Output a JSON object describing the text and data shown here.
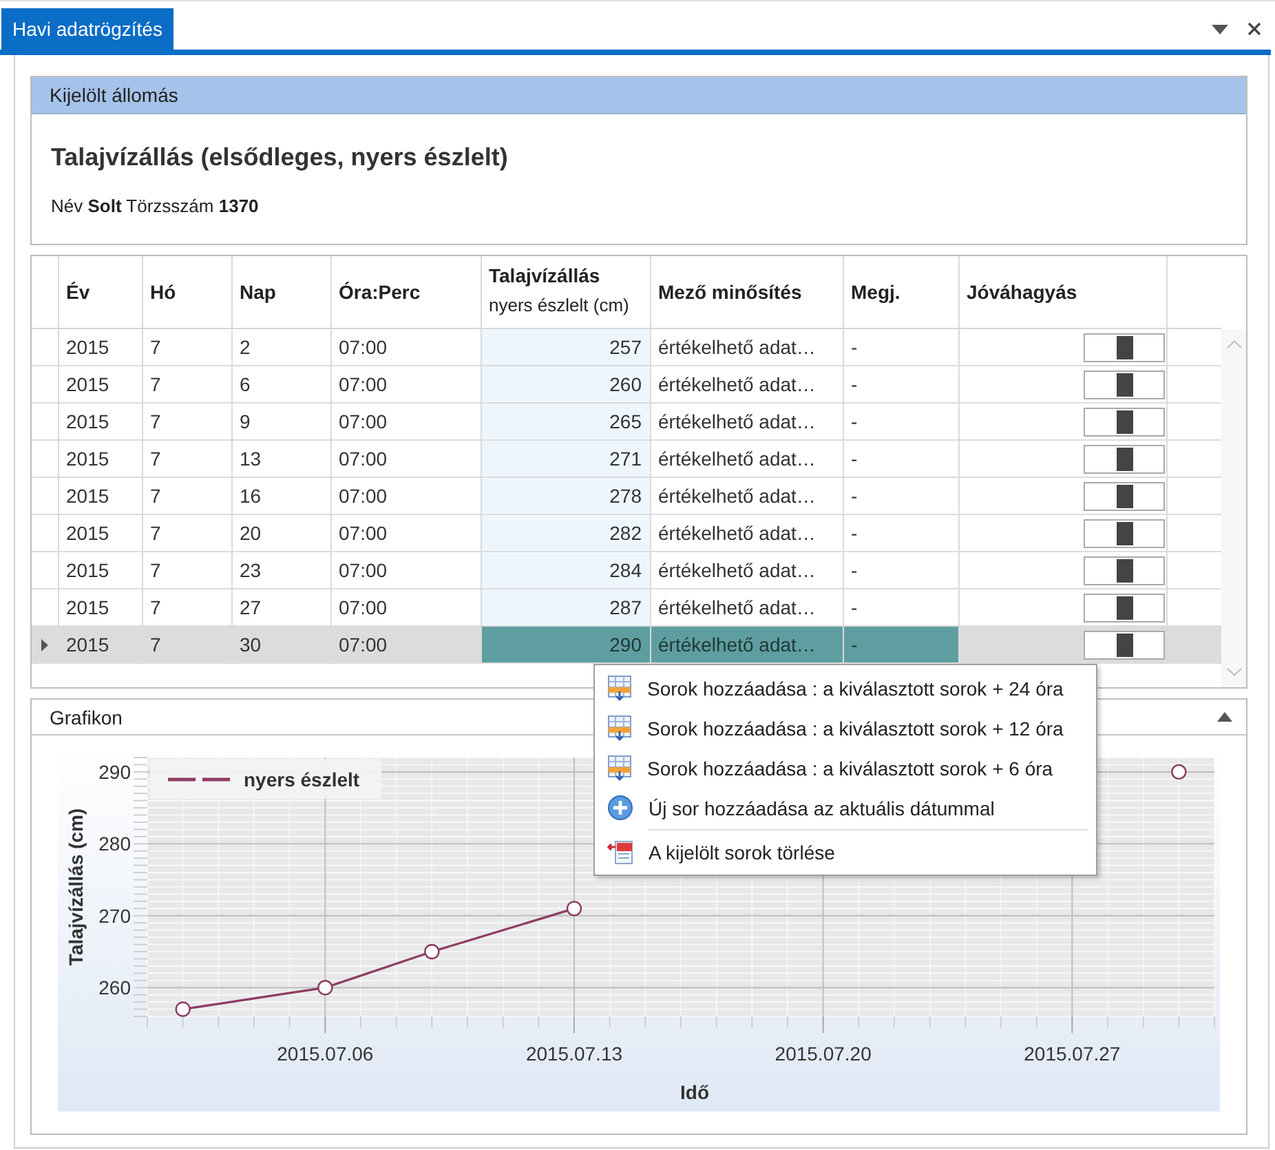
{
  "tab": {
    "title": "Havi adatrögzítés",
    "selected": true
  },
  "station": {
    "header": "Kijelölt állomás",
    "title": "Talajvízállás (elsődleges, nyers észlelt)",
    "info": "Név **Solt** Törzsszám **1370**"
  },
  "table": {
    "columns": [
      {
        "title": "Év"
      },
      {
        "title": "Hó"
      },
      {
        "title": "Nap"
      },
      {
        "title": "Óra:Perc"
      },
      {
        "title": "Talajvízállás",
        "subtitle": "nyers észlelt (cm)"
      },
      {
        "title": "Mező minősítés"
      },
      {
        "title": "Megj."
      },
      {
        "title": "Jóváhagyás"
      }
    ],
    "rows": [
      {
        "year": "2015",
        "month": "7",
        "day": "2",
        "time": "07:00",
        "value": "257",
        "quality": "értékelhető adat…",
        "note": "-",
        "approved": false,
        "selected": false
      },
      {
        "year": "2015",
        "month": "7",
        "day": "6",
        "time": "07:00",
        "value": "260",
        "quality": "értékelhető adat…",
        "note": "-",
        "approved": false,
        "selected": false
      },
      {
        "year": "2015",
        "month": "7",
        "day": "9",
        "time": "07:00",
        "value": "265",
        "quality": "értékelhető adat…",
        "note": "-",
        "approved": false,
        "selected": false
      },
      {
        "year": "2015",
        "month": "7",
        "day": "13",
        "time": "07:00",
        "value": "271",
        "quality": "értékelhető adat…",
        "note": "-",
        "approved": false,
        "selected": false
      },
      {
        "year": "2015",
        "month": "7",
        "day": "16",
        "time": "07:00",
        "value": "278",
        "quality": "értékelhető adat…",
        "note": "-",
        "approved": false,
        "selected": false
      },
      {
        "year": "2015",
        "month": "7",
        "day": "20",
        "time": "07:00",
        "value": "282",
        "quality": "értékelhető adat…",
        "note": "-",
        "approved": false,
        "selected": false
      },
      {
        "year": "2015",
        "month": "7",
        "day": "23",
        "time": "07:00",
        "value": "284",
        "quality": "értékelhető adat…",
        "note": "-",
        "approved": false,
        "selected": false
      },
      {
        "year": "2015",
        "month": "7",
        "day": "27",
        "time": "07:00",
        "value": "287",
        "quality": "értékelhető adat…",
        "note": "-",
        "approved": false,
        "selected": false
      },
      {
        "year": "2015",
        "month": "7",
        "day": "30",
        "time": "07:00",
        "value": "290",
        "quality": "értékelhető adat…",
        "note": "-",
        "approved": false,
        "selected": true
      }
    ]
  },
  "chart_panel": {
    "title": "Grafikon",
    "expanded": true,
    "chart_data": {
      "type": "line",
      "xlabel": "Idő",
      "ylabel": "Talajvízállás (cm)",
      "x": [
        "2015-07-02",
        "2015-07-06",
        "2015-07-09",
        "2015-07-13",
        "2015-07-16",
        "2015-07-20",
        "2015-07-23",
        "2015-07-27",
        "2015-07-30"
      ],
      "series": [
        {
          "name": "nyers észlelt",
          "color": "#8e3b63",
          "marker": true,
          "values": [
            257,
            260,
            265,
            271,
            null,
            null,
            null,
            null,
            290
          ]
        }
      ],
      "grid": true,
      "xlim": [
        "2015-07-01",
        "2015-07-31"
      ],
      "ylim": [
        256,
        292
      ],
      "xticks": [
        {
          "value": "2015-07-06",
          "label": "2015.07.06"
        },
        {
          "value": "2015-07-13",
          "label": "2015.07.13"
        },
        {
          "value": "2015-07-20",
          "label": "2015.07.20"
        },
        {
          "value": "2015-07-27",
          "label": "2015.07.27"
        }
      ],
      "yticks": [
        260,
        270,
        280,
        290
      ]
    }
  },
  "context_menu": {
    "items": [
      {
        "kind": "add_rows",
        "label": "Sorok hozzáadása : a kiválasztott sorok + 24 óra",
        "separator_above": false
      },
      {
        "kind": "add_rows",
        "label": "Sorok hozzáadása : a kiválasztott sorok + 12 óra",
        "separator_above": false
      },
      {
        "kind": "add_rows",
        "label": "Sorok hozzáadása : a kiválasztott sorok + 6 óra",
        "separator_above": false
      },
      {
        "kind": "add_row",
        "label": "Új sor hozzáadása az aktuális dátummal",
        "separator_above": false
      },
      {
        "kind": "delete",
        "label": "A kijelölt sorok törlése",
        "separator_above": true
      }
    ]
  }
}
